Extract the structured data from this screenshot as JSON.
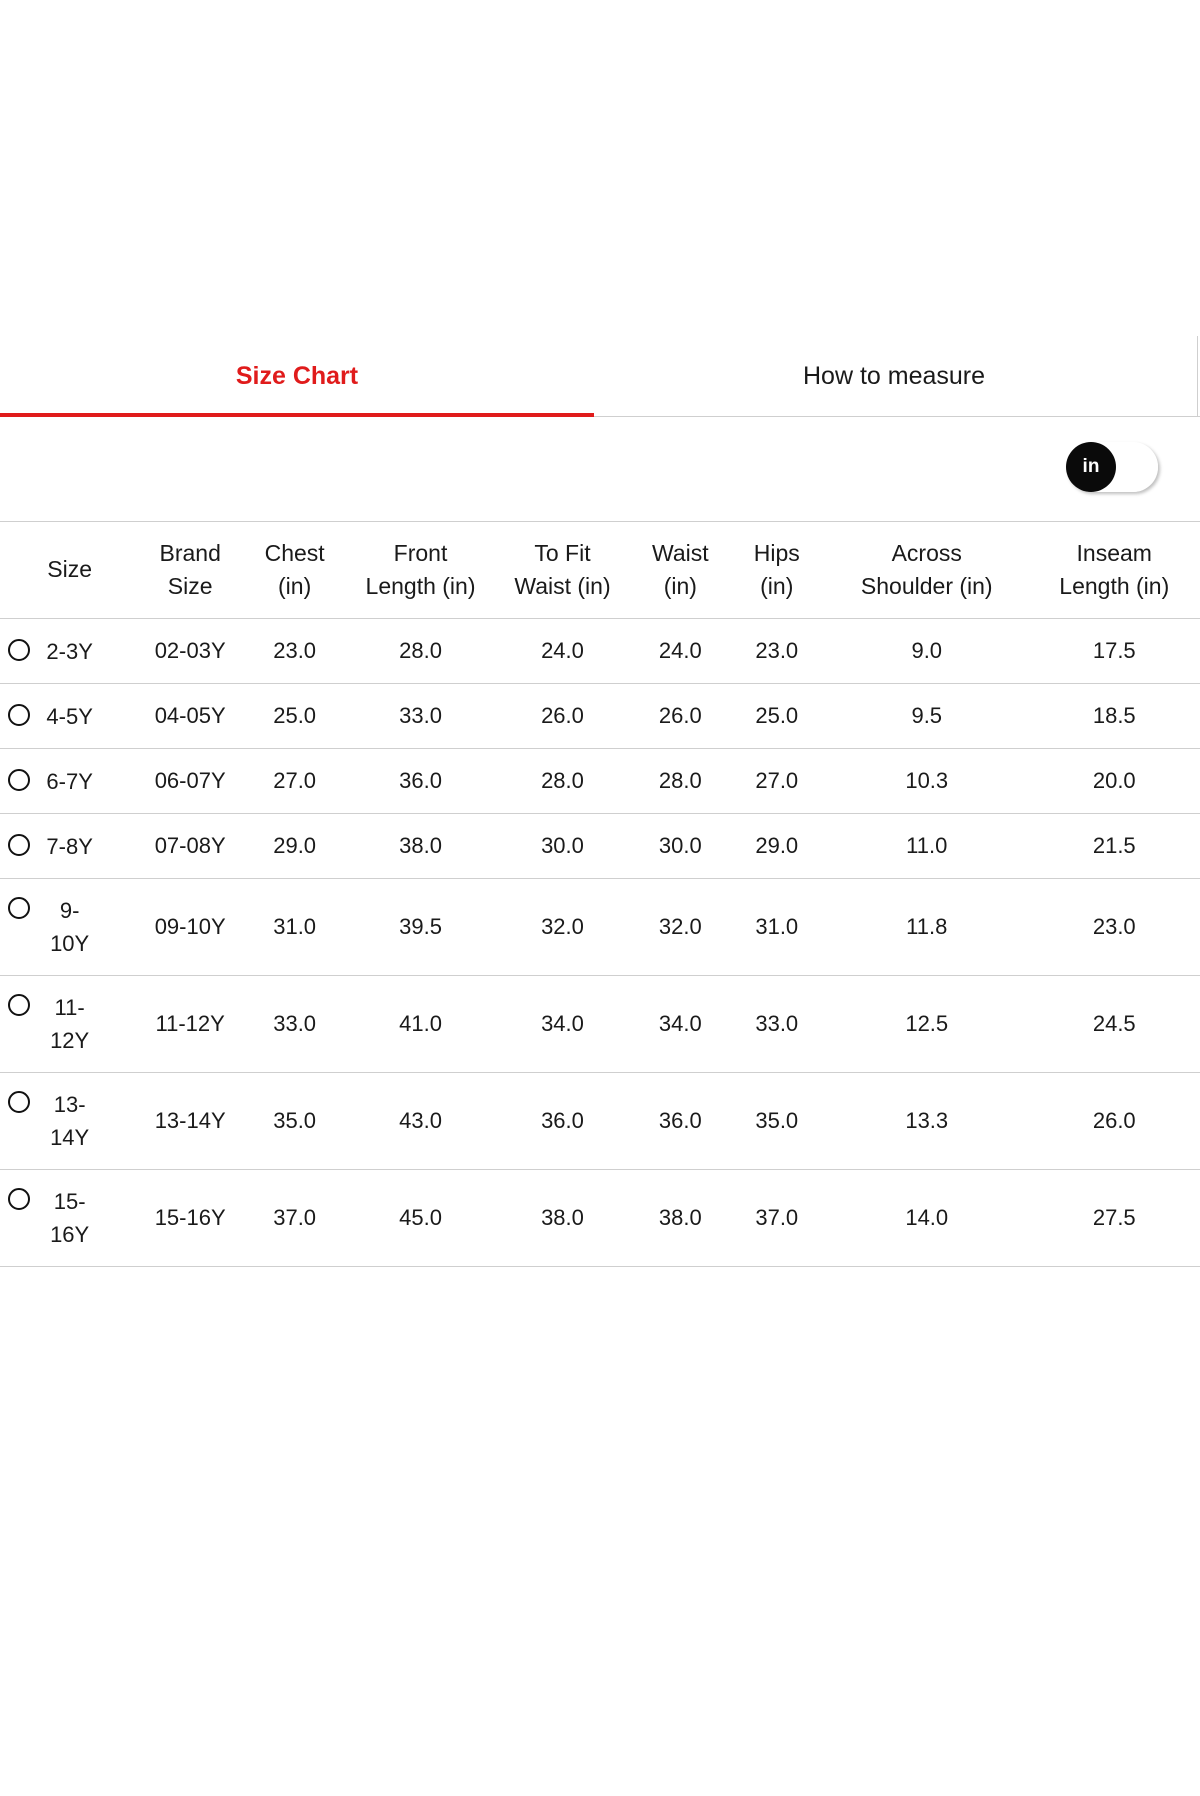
{
  "tabs": {
    "size_chart": "Size Chart",
    "how_to_measure": "How to measure"
  },
  "unit_toggle": {
    "active": "in"
  },
  "colors": {
    "accent": "#e01b1b",
    "text": "#1a1a1a",
    "divider": "#cfcfcf"
  },
  "table": {
    "headers": [
      [
        "Size"
      ],
      [
        "Brand",
        "Size"
      ],
      [
        "Chest",
        "(in)"
      ],
      [
        "Front",
        "Length (in)"
      ],
      [
        "To Fit",
        "Waist (in)"
      ],
      [
        "Waist",
        "(in)"
      ],
      [
        "Hips",
        "(in)"
      ],
      [
        "Across",
        "Shoulder (in)"
      ],
      [
        "Inseam",
        "Length (in)"
      ]
    ],
    "rows": [
      {
        "size": "2-3Y",
        "brand_size": "02-03Y",
        "chest": "23.0",
        "front_length": "28.0",
        "to_fit_waist": "24.0",
        "waist": "24.0",
        "hips": "23.0",
        "across_shoulder": "9.0",
        "inseam_length": "17.5"
      },
      {
        "size": "4-5Y",
        "brand_size": "04-05Y",
        "chest": "25.0",
        "front_length": "33.0",
        "to_fit_waist": "26.0",
        "waist": "26.0",
        "hips": "25.0",
        "across_shoulder": "9.5",
        "inseam_length": "18.5"
      },
      {
        "size": "6-7Y",
        "brand_size": "06-07Y",
        "chest": "27.0",
        "front_length": "36.0",
        "to_fit_waist": "28.0",
        "waist": "28.0",
        "hips": "27.0",
        "across_shoulder": "10.3",
        "inseam_length": "20.0"
      },
      {
        "size": "7-8Y",
        "brand_size": "07-08Y",
        "chest": "29.0",
        "front_length": "38.0",
        "to_fit_waist": "30.0",
        "waist": "30.0",
        "hips": "29.0",
        "across_shoulder": "11.0",
        "inseam_length": "21.5"
      },
      {
        "size": "9-10Y",
        "size_line1": "9-",
        "size_line2": "10Y",
        "brand_size": "09-10Y",
        "chest": "31.0",
        "front_length": "39.5",
        "to_fit_waist": "32.0",
        "waist": "32.0",
        "hips": "31.0",
        "across_shoulder": "11.8",
        "inseam_length": "23.0"
      },
      {
        "size": "11-12Y",
        "size_line1": "11-",
        "size_line2": "12Y",
        "brand_size": "11-12Y",
        "chest": "33.0",
        "front_length": "41.0",
        "to_fit_waist": "34.0",
        "waist": "34.0",
        "hips": "33.0",
        "across_shoulder": "12.5",
        "inseam_length": "24.5"
      },
      {
        "size": "13-14Y",
        "size_line1": "13-",
        "size_line2": "14Y",
        "brand_size": "13-14Y",
        "chest": "35.0",
        "front_length": "43.0",
        "to_fit_waist": "36.0",
        "waist": "36.0",
        "hips": "35.0",
        "across_shoulder": "13.3",
        "inseam_length": "26.0"
      },
      {
        "size": "15-16Y",
        "size_line1": "15-",
        "size_line2": "16Y",
        "brand_size": "15-16Y",
        "chest": "37.0",
        "front_length": "45.0",
        "to_fit_waist": "38.0",
        "waist": "38.0",
        "hips": "37.0",
        "across_shoulder": "14.0",
        "inseam_length": "27.5"
      }
    ]
  }
}
